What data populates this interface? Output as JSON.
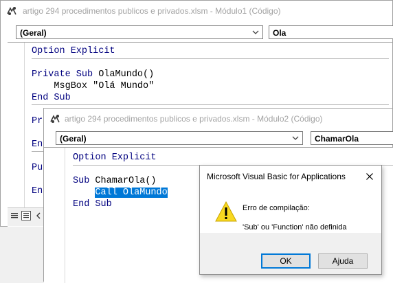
{
  "window1": {
    "title": "artigo 294 procedimentos publicos e privados.xlsm - Módulo1 (Código)",
    "object_combo": "(Geral)",
    "proc_combo": "Ola",
    "code": {
      "line1_kw": "Option Explicit",
      "line2_kw": "Private Sub",
      "line2_tx": " OlaMundo()",
      "line3_tx": "    MsgBox \"Olá Mundo\"",
      "line4_kw": "End Sub",
      "line5_kw": "Pr",
      "line6_kw": "En",
      "line7_kw": "Pu",
      "line8_kw": "En"
    }
  },
  "window2": {
    "title": "artigo 294 procedimentos publicos e privados.xlsm - Módulo2 (Código)",
    "object_combo": "(Geral)",
    "proc_combo": "ChamarOla",
    "code": {
      "line1_kw": "Option Explicit",
      "line2_kw": "Sub",
      "line2_tx": " ChamarOla()",
      "line3_sel": "Call OlaMundo",
      "line4_kw": "End Sub"
    }
  },
  "dialog": {
    "title": "Microsoft Visual Basic for Applications",
    "heading": "Erro de compilação:",
    "message": "'Sub' ou 'Function' não definida",
    "ok_label": "OK",
    "help_label": "Ajuda",
    "icon": "warning-icon"
  },
  "colors": {
    "keyword": "#00007f",
    "selection": "#0078d7",
    "title_inactive": "#a3a3a3"
  }
}
